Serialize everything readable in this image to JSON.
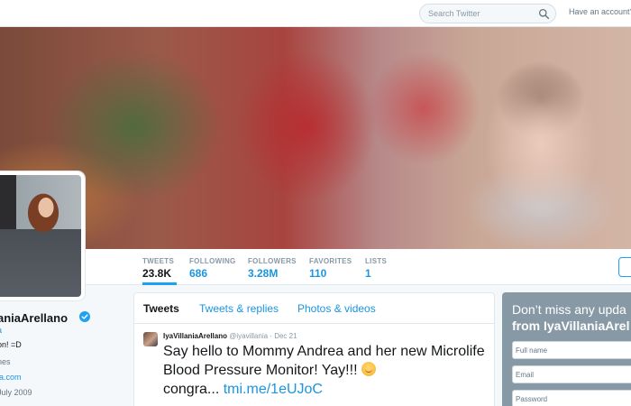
{
  "topbar": {
    "search_placeholder": "Search Twitter",
    "have_account": "Have an account?"
  },
  "stats": [
    {
      "label": "TWEETS",
      "value": "23.8K"
    },
    {
      "label": "FOLLOWING",
      "value": "686"
    },
    {
      "label": "FOLLOWERS",
      "value": "3.28M"
    },
    {
      "label": "FAVORITES",
      "value": "110"
    },
    {
      "label": "LISTS",
      "value": "1"
    }
  ],
  "profile": {
    "name": "aniaArellano",
    "handle_fragment": "a",
    "bio": "on! =D",
    "location": "nes",
    "website": "ia.com",
    "joined": "July 2009"
  },
  "timeline": {
    "tabs": [
      "Tweets",
      "Tweets & replies",
      "Photos & videos"
    ],
    "tweet": {
      "name": "IyaVillaniaArellano",
      "handle": "@iyavillania",
      "separator": "·",
      "date": "Dec 21",
      "text": "Say hello to Mommy Andrea and her new Microlife Blood Pressure Monitor! Yay!!!",
      "text_tail": "congra...",
      "link": "tmi.me/1eUJoC"
    }
  },
  "signup": {
    "title": "Don’t miss any upda",
    "title_bold": "from IyaVillaniaArel",
    "fields": [
      "Full name",
      "Email",
      "Password"
    ]
  },
  "colors": {
    "accent": "#1da1f2",
    "link": "#1b95e0",
    "signup_bg": "#8899a6"
  }
}
